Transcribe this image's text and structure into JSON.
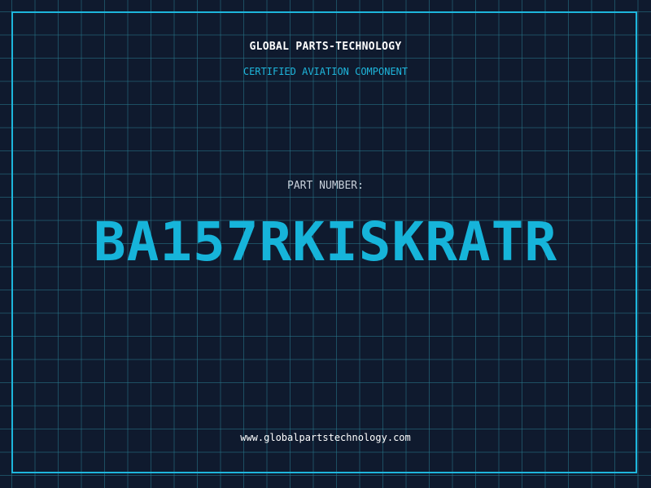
{
  "header": {
    "brand": "GLOBAL PARTS-TECHNOLOGY",
    "subtitle": "CERTIFIED AVIATION COMPONENT"
  },
  "part": {
    "label": "PART NUMBER:",
    "number": "BA157RKISKRATR"
  },
  "footer": {
    "url": "www.globalpartstechnology.com"
  },
  "colors": {
    "background": "#0f1a2e",
    "accent": "#1eb6dc",
    "grid": "#28788c",
    "text": "#ffffff"
  }
}
